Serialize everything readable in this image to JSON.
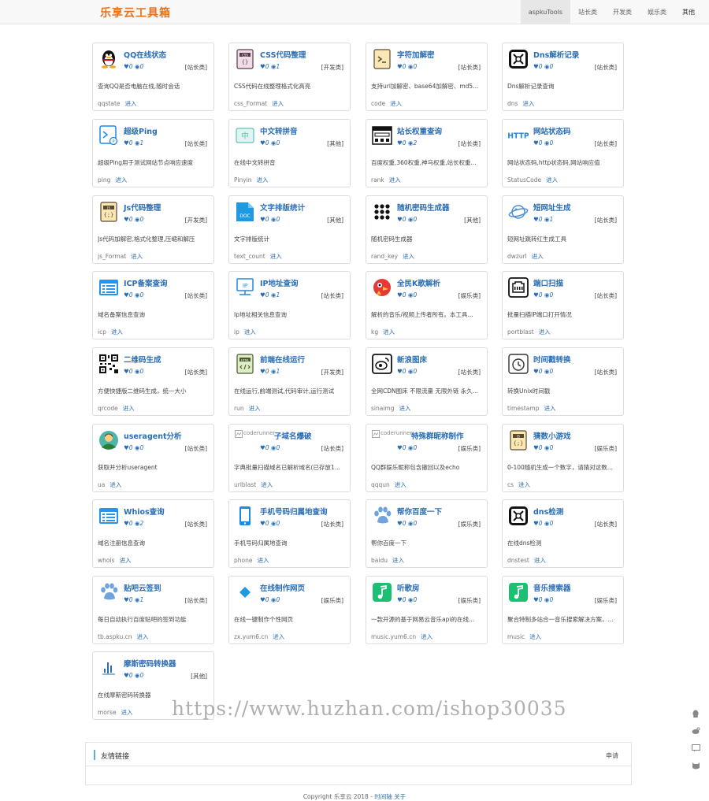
{
  "brand": "乐享云工具箱",
  "nav": [
    "aspkuTools",
    "站长类",
    "开发类",
    "娱乐类",
    "其他"
  ],
  "tools": [
    {
      "title": "QQ在线状态",
      "likes": "0",
      "views": "0",
      "category": "[站长类]",
      "desc": "查询QQ是否电脑在线,随时会话",
      "slug": "qqstate",
      "icon": "qq-penguin-icon"
    },
    {
      "title": "CSS代码整理",
      "likes": "0",
      "views": "1",
      "category": "[开发类]",
      "desc": "CSS代码在线整理格式化高亮",
      "slug": "css_Format",
      "icon": "css-file-icon"
    },
    {
      "title": "字符加解密",
      "likes": "0",
      "views": "0",
      "category": "[站长类]",
      "desc": "支持url加解密、base64加解密、md5...",
      "slug": "code",
      "icon": "terminal-file-icon"
    },
    {
      "title": "Dns解析记录",
      "likes": "0",
      "views": "0",
      "category": "[站长类]",
      "desc": "Dns解析记录查询",
      "slug": "dns",
      "icon": "dns-icon"
    },
    {
      "title": "超级Ping",
      "likes": "0",
      "views": "1",
      "category": "[站长类]",
      "desc": "超级Ping用于测试网站节点响应速度",
      "slug": "ping",
      "icon": "ping-terminal-icon"
    },
    {
      "title": "中文转拼音",
      "likes": "0",
      "views": "0",
      "category": "[其他]",
      "desc": "在线中文转拼音",
      "slug": "Pinyin",
      "icon": "pinyin-icon"
    },
    {
      "title": "站长权重查询",
      "likes": "0",
      "views": "2",
      "category": "[站长类]",
      "desc": "百度权重,360权重,神马权重,站长权重...",
      "slug": "rank",
      "icon": "rank-browser-icon"
    },
    {
      "title": "网站状态码",
      "likes": "0",
      "views": "0",
      "category": "[站长类]",
      "desc": "网站状态码,http状态码,网站响应值",
      "slug": "StatusCode",
      "icon": "http-icon"
    },
    {
      "title": "Js代码整理",
      "likes": "0",
      "views": "0",
      "category": "[开发类]",
      "desc": "Js代码加解密,格式化整理,压缩和解压",
      "slug": "js_Format",
      "icon": "js-file-icon"
    },
    {
      "title": "文字排版统计",
      "likes": "0",
      "views": "0",
      "category": "[其他]",
      "desc": "文字排版统计",
      "slug": "text_count",
      "icon": "doc-icon"
    },
    {
      "title": "随机密码生成器",
      "likes": "0",
      "views": "0",
      "category": "[其他]",
      "desc": "随机密码生成器",
      "slug": "rand_key",
      "icon": "keypad-icon"
    },
    {
      "title": "短网址生成",
      "likes": "0",
      "views": "1",
      "category": "[站长类]",
      "desc": "短网址跳转红生成工具",
      "slug": "dwzurl",
      "icon": "planet-icon"
    },
    {
      "title": "ICP备案查询",
      "likes": "0",
      "views": "0",
      "category": "[站长类]",
      "desc": "域名备案信息查询",
      "slug": "icp",
      "icon": "window-list-icon"
    },
    {
      "title": "IP地址查询",
      "likes": "0",
      "views": "1",
      "category": "[站长类]",
      "desc": "Ip地址相关信息查询",
      "slug": "ip",
      "icon": "ip-monitor-icon"
    },
    {
      "title": "全民K歌解析",
      "likes": "0",
      "views": "0",
      "category": "[娱乐类]",
      "desc": "解析的音乐/视频上传者所有。本工具...",
      "slug": "kg",
      "icon": "bird-icon"
    },
    {
      "title": "端口扫描",
      "likes": "0",
      "views": "0",
      "category": "[站长类]",
      "desc": "批量扫描IP端口打开情况",
      "slug": "portblast",
      "icon": "ethernet-port-icon"
    },
    {
      "title": "二维码生成",
      "likes": "0",
      "views": "0",
      "category": "[站长类]",
      "desc": "方便快捷版二维码生成，统一大小",
      "slug": "qrcode",
      "icon": "qrcode-icon"
    },
    {
      "title": "前端在线运行",
      "likes": "0",
      "views": "1",
      "category": "[开发类]",
      "desc": "在线运行,前端测试,代码审计,运行测试",
      "slug": "run",
      "icon": "html-file-icon"
    },
    {
      "title": "新浪图床",
      "likes": "0",
      "views": "0",
      "category": "[站长类]",
      "desc": "全网CDN图床 不限流量 无限外链 永久...",
      "slug": "sinaimg",
      "icon": "weibo-icon"
    },
    {
      "title": "时间戳转换",
      "likes": "0",
      "views": "0",
      "category": "[站长类]",
      "desc": "转换Unix时间戳",
      "slug": "timestamp",
      "icon": "clock-icon"
    },
    {
      "title": "useragent分析",
      "likes": "0",
      "views": "0",
      "category": "[站长类]",
      "desc": "获取并分析useragent",
      "slug": "ua",
      "icon": "user-avatar-icon"
    },
    {
      "title": "子域名爆破",
      "likes": "0",
      "views": "0",
      "category": "[站长类]",
      "desc": "字典批量扫描域名已解析域名(已存放1...",
      "slug": "urlblast",
      "icon": "broken-image-icon",
      "alt": "coderunner"
    },
    {
      "title": "特殊群昵称制作",
      "likes": "0",
      "views": "0",
      "category": "[娱乐类]",
      "desc": "QQ群娱乐昵称包含撤回以及echo",
      "slug": "qqqun",
      "icon": "broken-image-icon",
      "alt": "coderunner"
    },
    {
      "title": "猜数小游戏",
      "likes": "0",
      "views": "0",
      "category": "[娱乐类]",
      "desc": "0-100随机生成一个数字，请猜对这数...",
      "slug": "cs",
      "icon": "js-file-icon"
    },
    {
      "title": "Whios查询",
      "likes": "0",
      "views": "2",
      "category": "[站长类]",
      "desc": "域名注册信息查询",
      "slug": "whois",
      "icon": "window-list-icon"
    },
    {
      "title": "手机号码归属地查询",
      "likes": "0",
      "views": "0",
      "category": "[站长类]",
      "desc": "手机号码归属地查询",
      "slug": "phone",
      "icon": "phone-icon"
    },
    {
      "title": "帮你百度一下",
      "likes": "0",
      "views": "0",
      "category": "[娱乐类]",
      "desc": "帮你百度一下",
      "slug": "baidu",
      "icon": "paw-icon"
    },
    {
      "title": "dns检测",
      "likes": "0",
      "views": "0",
      "category": "[站长类]",
      "desc": "在线dns检测",
      "slug": "dnstest",
      "icon": "dns-icon"
    },
    {
      "title": "贴吧云签到",
      "likes": "0",
      "views": "1",
      "category": "[站长类]",
      "desc": "每日自动执行百度贴吧的签到功能",
      "slug": "tb.aspku.cn",
      "icon": "paw-icon"
    },
    {
      "title": "在线制作网页",
      "likes": "0",
      "views": "0",
      "category": "[娱乐类]",
      "desc": "在线一键制作个性网页",
      "slug": "zx.yum6.cn",
      "icon": "diamond-icon"
    },
    {
      "title": "听歌房",
      "likes": "0",
      "views": "0",
      "category": "[娱乐类]",
      "desc": "一款开源的基于网易云音乐api的在线...",
      "slug": "music.yum6.cn",
      "icon": "music-note-icon"
    },
    {
      "title": "音乐搜索器",
      "likes": "0",
      "views": "0",
      "category": "[娱乐类]",
      "desc": "聚合特制多站合一音乐搜索解决方案，...",
      "slug": "music",
      "icon": "music-note-icon"
    },
    {
      "title": "摩斯密码转换器",
      "likes": "0",
      "views": "0",
      "category": "[其他]",
      "desc": "在线摩斯密码转换器",
      "slug": "morse",
      "icon": "morse-bars-icon"
    }
  ],
  "go_label": "进入",
  "links": {
    "title": "友情链接",
    "apply": "申请"
  },
  "footer": {
    "copyright": "Copyright 乐享云 2018 - ",
    "link1": "时间轴",
    "link2": "关于"
  },
  "watermark": "https://www.huzhan.com/ishop30035",
  "colors": {
    "accent": "#2a6db5",
    "brand": "#e8731f"
  }
}
